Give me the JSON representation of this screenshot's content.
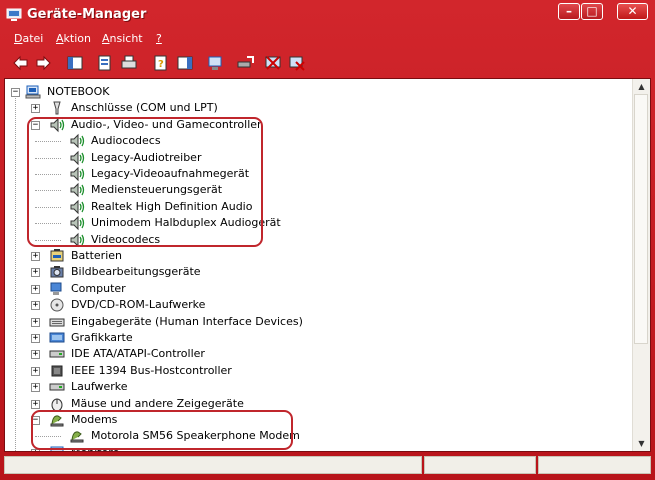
{
  "window": {
    "title": "Geräte-Manager"
  },
  "menu": [
    {
      "label": "Datei",
      "u": "D",
      "rest": "atei"
    },
    {
      "label": "Aktion",
      "u": "A",
      "rest": "ktion"
    },
    {
      "label": "Ansicht",
      "u": "A",
      "rest": "nsicht"
    },
    {
      "label": "?",
      "u": "?",
      "rest": ""
    }
  ],
  "toolbar": [
    "back-icon",
    "forward-icon",
    "show-hide-tree-icon",
    "properties-icon",
    "print-icon",
    "help-icon",
    "show-hide-action-pane-icon",
    "scan-hardware-icon",
    "update-driver-icon",
    "disable-device-icon",
    "uninstall-device-icon"
  ],
  "tree": {
    "root": "NOTEBOOK",
    "nodes": [
      {
        "label": "Anschlüsse (COM und LPT)",
        "expanded": false
      },
      {
        "label": "Audio-, Video- und Gamecontroller",
        "expanded": true,
        "children": [
          "Audiocodecs",
          "Legacy-Audiotreiber",
          "Legacy-Videoaufnahmegerät",
          "Mediensteuerungsgerät",
          "Realtek High Definition Audio",
          "Unimodem Halbduplex Audiogerät",
          "Videocodecs"
        ]
      },
      {
        "label": "Batterien",
        "expanded": false
      },
      {
        "label": "Bildbearbeitungsgeräte",
        "expanded": false
      },
      {
        "label": "Computer",
        "expanded": false
      },
      {
        "label": "DVD/CD-ROM-Laufwerke",
        "expanded": false
      },
      {
        "label": "Eingabegeräte (Human Interface Devices)",
        "expanded": false
      },
      {
        "label": "Grafikkarte",
        "expanded": false
      },
      {
        "label": "IDE ATA/ATAPI-Controller",
        "expanded": false
      },
      {
        "label": "IEEE 1394 Bus-Hostcontroller",
        "expanded": false
      },
      {
        "label": "Laufwerke",
        "expanded": false
      },
      {
        "label": "Mäuse und andere Zeigegeräte",
        "expanded": false
      },
      {
        "label": "Modems",
        "expanded": true,
        "children": [
          "Motorola SM56 Speakerphone Modem"
        ]
      },
      {
        "label": "Monitore",
        "expanded": false
      }
    ]
  },
  "colors": {
    "frame": "#c4161c",
    "highlight": "#c0262c",
    "accent": "#1c5fb8"
  }
}
